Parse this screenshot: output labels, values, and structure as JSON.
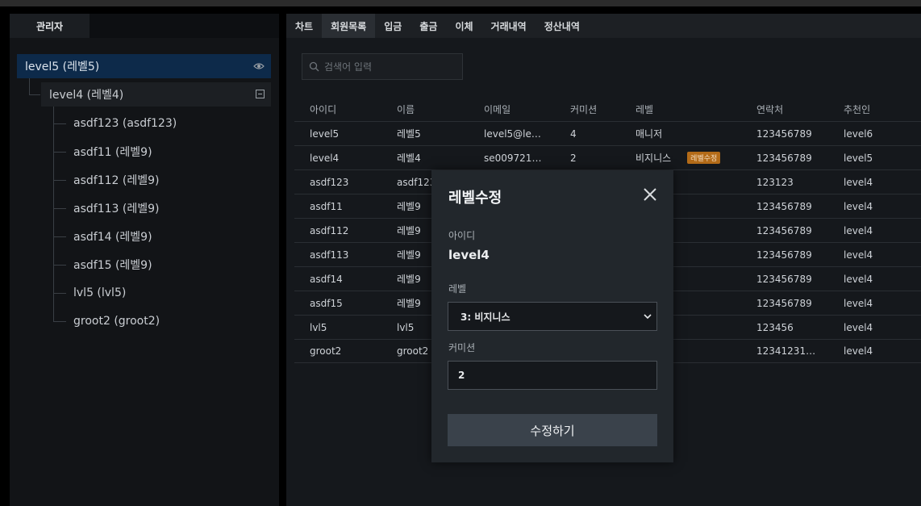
{
  "admin_tab": "관리자",
  "tree": {
    "root": "level5 (레벨5)",
    "child": "level4 (레벨4)",
    "leaves": [
      "asdf123 (asdf123)",
      "asdf11 (레벨9)",
      "asdf112 (레벨9)",
      "asdf113 (레벨9)",
      "asdf14 (레벨9)",
      "asdf15 (레벨9)",
      "lvl5 (lvl5)",
      "groot2 (groot2)"
    ]
  },
  "tabs": [
    "차트",
    "회원목록",
    "입금",
    "출금",
    "이체",
    "거래내역",
    "정산내역"
  ],
  "search": {
    "placeholder": "검색어 입력"
  },
  "table": {
    "headers": [
      "아이디",
      "이름",
      "이메일",
      "커미션",
      "레벨",
      "연락처",
      "추천인"
    ],
    "rows": [
      [
        "level5",
        "레벨5",
        "level5@le…",
        "4",
        "매니저",
        "123456789",
        "level6"
      ],
      [
        "level4",
        "레벨4",
        "se009721…",
        "2",
        "비지니스",
        "123456789",
        "level5"
      ],
      [
        "asdf123",
        "asdf123",
        "",
        "",
        "",
        "123123",
        "level4"
      ],
      [
        "asdf11",
        "레벨9",
        "",
        "",
        "",
        "123456789",
        "level4"
      ],
      [
        "asdf112",
        "레벨9",
        "",
        "",
        "",
        "123456789",
        "level4"
      ],
      [
        "asdf113",
        "레벨9",
        "",
        "",
        "",
        "123456789",
        "level4"
      ],
      [
        "asdf14",
        "레벨9",
        "",
        "",
        "",
        "123456789",
        "level4"
      ],
      [
        "asdf15",
        "레벨9",
        "",
        "",
        "",
        "123456789",
        "level4"
      ],
      [
        "lvl5",
        "lvl5",
        "",
        "",
        "",
        "123456",
        "level4"
      ],
      [
        "groot2",
        "groot2",
        "",
        "",
        "",
        "12341231…",
        "level4"
      ]
    ],
    "edit_badge": "레벨수정"
  },
  "modal": {
    "title": "레벨수정",
    "id_label": "아이디",
    "id_value": "level4",
    "level_label": "레벨",
    "level_selected": "3: 비지니스",
    "commission_label": "커미션",
    "commission_value": "2",
    "submit_label": "수정하기"
  },
  "colors": {
    "selected_row": "#0d2a4a",
    "badge": "#b36b18",
    "button": "#3a424b"
  }
}
